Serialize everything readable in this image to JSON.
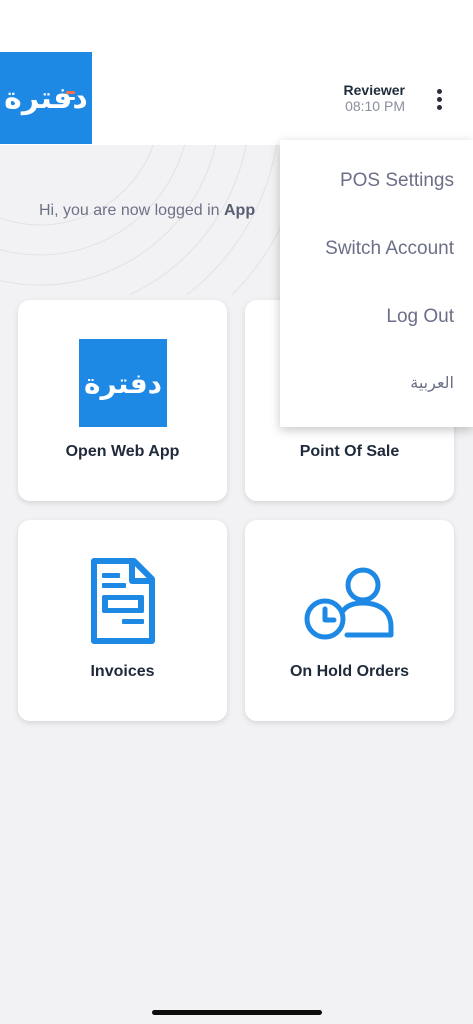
{
  "header": {
    "logo_text": "دفترة",
    "user_name": "Reviewer",
    "time": "08:10 PM"
  },
  "welcome": {
    "text": "Hi, you are now logged in ",
    "bold": "App"
  },
  "cards": {
    "web_app": {
      "label": "Open Web App",
      "logo_text": "دفترة"
    },
    "pos": {
      "label": "Point Of Sale"
    },
    "invoices": {
      "label": "Invoices",
      "icon": "invoice-icon"
    },
    "on_hold": {
      "label": "On Hold Orders",
      "icon": "user-clock-icon"
    }
  },
  "menu": {
    "pos_settings": "POS Settings",
    "switch_account": "Switch Account",
    "log_out": "Log Out",
    "arabic": "العربية"
  },
  "colors": {
    "brand_blue": "#1e88e5",
    "accent_orange": "#ff7043",
    "background": "#f2f2f4",
    "menu_text": "#6b6f87"
  }
}
